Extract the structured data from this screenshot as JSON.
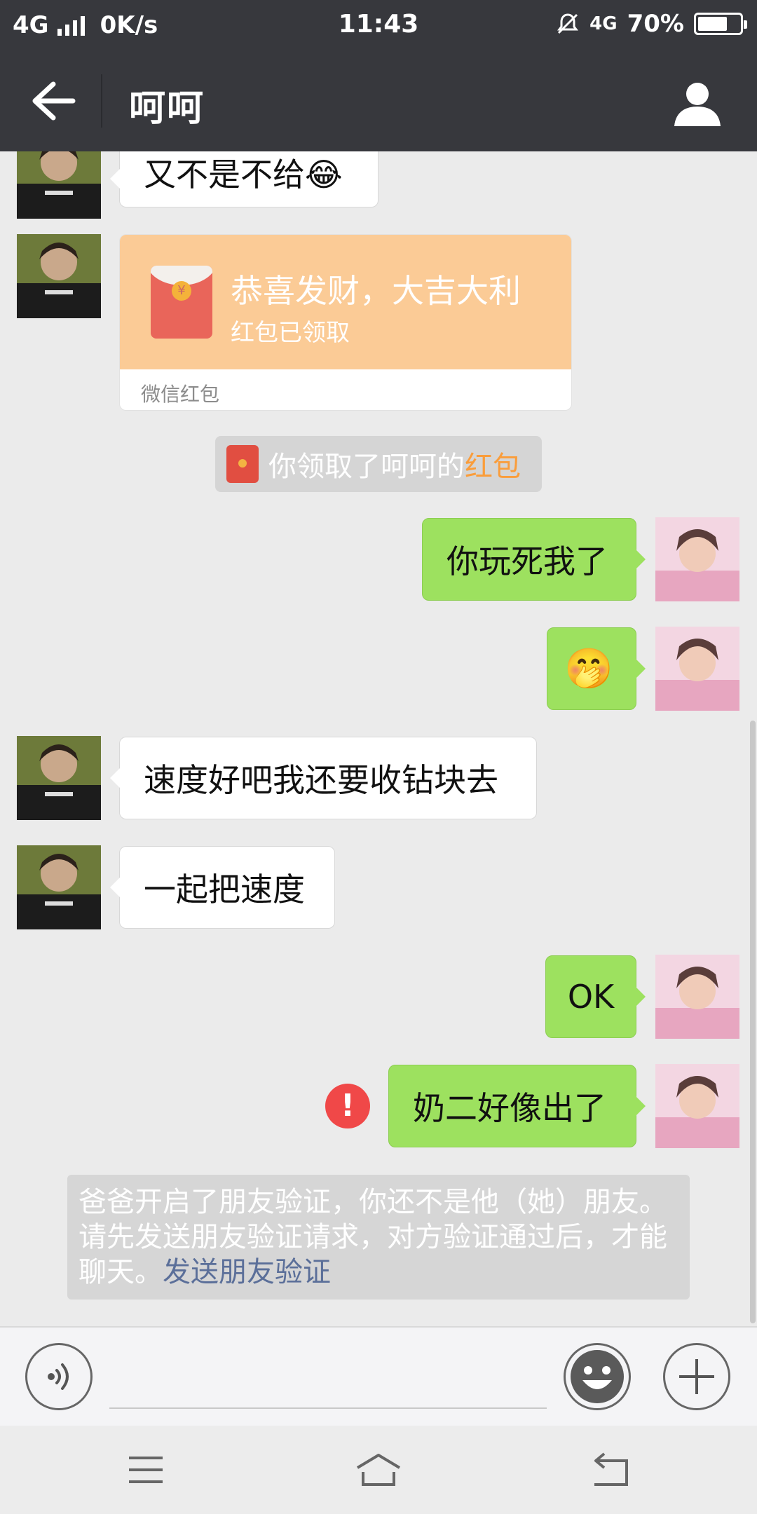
{
  "status_bar": {
    "network": "4G",
    "speed": "0K/s",
    "time": "11:43",
    "network_right": "4G",
    "battery": "70%",
    "battery_level": 0.7
  },
  "header": {
    "title": "呵呵"
  },
  "messages": {
    "m1": "又不是不给😂",
    "red_packet": {
      "greeting": "恭喜发财，大吉大利",
      "status": "红包已领取",
      "footer": "微信红包"
    },
    "system_notice": {
      "prefix": "你领取了呵呵的",
      "highlight": "红包"
    },
    "m3": "你玩死我了",
    "m4": "🤭",
    "m5": "速度好吧我还要收钻块去",
    "m6": "一起把速度",
    "m7": "OK",
    "m8": "奶二好像出了",
    "error_mark": "!",
    "friend_verification": {
      "text": "爸爸开启了朋友验证，你还不是他（她）朋友。请先发送朋友验证请求，对方验证通过后，才能聊天。",
      "link": "发送朋友验证"
    }
  },
  "colors": {
    "header_bg": "#37383d",
    "chat_bg": "#ebebeb",
    "my_bubble": "#9de15f",
    "red_packet": "#fbcb96",
    "highlight": "#fa9d3b",
    "link": "#5b6f99",
    "error": "#f04848"
  },
  "icons": {
    "back": "arrow-left-icon",
    "profile": "person-icon",
    "voice": "voice-icon",
    "emoji": "smiley-icon",
    "add": "plus-icon",
    "menu": "menu-icon",
    "home": "home-icon",
    "return": "return-icon"
  }
}
